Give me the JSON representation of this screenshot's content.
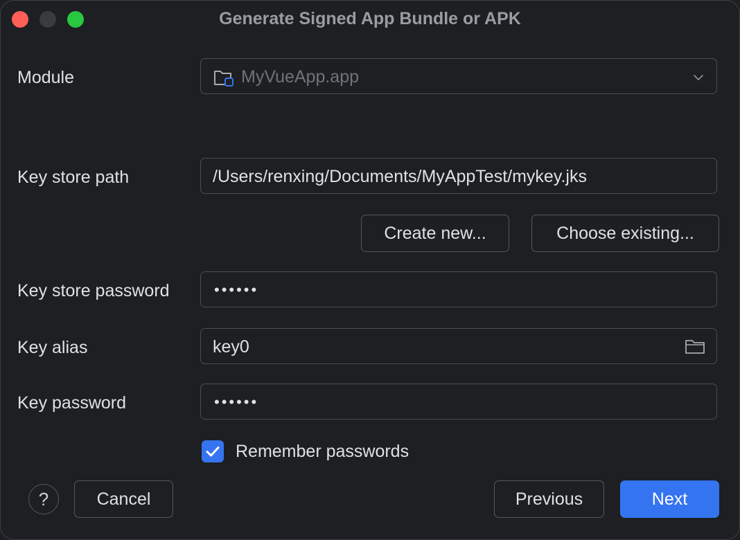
{
  "window": {
    "title": "Generate Signed App Bundle or APK"
  },
  "form": {
    "module_label": "Module",
    "module_value": "MyVueApp.app",
    "keystore_path_label": "Key store path",
    "keystore_path_value": "/Users/renxing/Documents/MyAppTest/mykey.jks",
    "create_new_label": "Create new...",
    "choose_existing_label": "Choose existing...",
    "keystore_password_label": "Key store password",
    "keystore_password_value": "••••••",
    "key_alias_label": "Key alias",
    "key_alias_value": "key0",
    "key_password_label": "Key password",
    "key_password_value": "••••••",
    "remember_label": "Remember passwords",
    "remember_checked": true
  },
  "footer": {
    "help_label": "?",
    "cancel_label": "Cancel",
    "previous_label": "Previous",
    "next_label": "Next"
  },
  "colors": {
    "background": "#1e1f22",
    "accent": "#3574f0",
    "close": "#ff5f57",
    "maximize": "#28c840"
  }
}
